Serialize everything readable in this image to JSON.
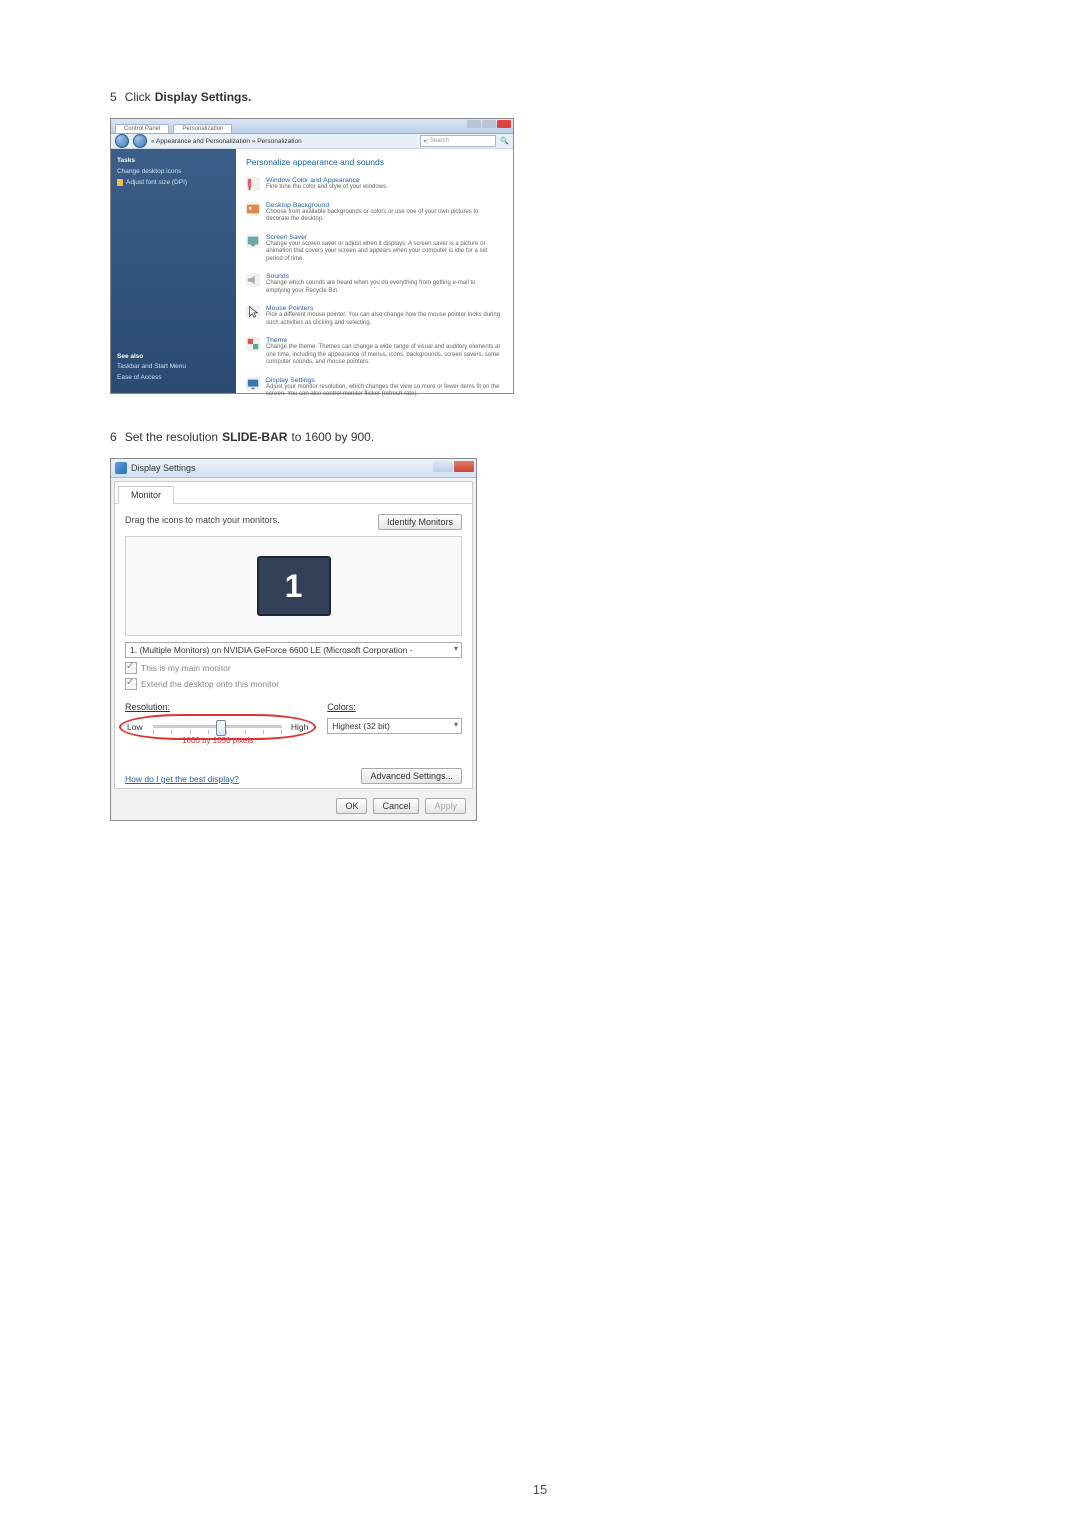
{
  "page_number": "15",
  "step5": {
    "num": "5",
    "prefix": "Click ",
    "bold": "Display Settings."
  },
  "step6": {
    "num": "6",
    "prefix": "Set the resolution ",
    "bold": "SLIDE-BAR",
    "suffix": " to 1600 by 900."
  },
  "win1": {
    "tab_control": "Control Panel",
    "tab_personalize": "Personalization",
    "breadcrumb": "« Appearance and Personalization » Personalization",
    "search_placeholder": "Search",
    "sidebar": {
      "heading": "Tasks",
      "link1": "Change desktop icons",
      "link2": "Adjust font size (DPI)",
      "also": "See also",
      "also1": "Taskbar and Start Menu",
      "also2": "Ease of Access"
    },
    "main_title": "Personalize appearance and sounds",
    "items": [
      {
        "title": "Window Color and Appearance",
        "desc": "Fine tune the color and style of your windows."
      },
      {
        "title": "Desktop Background",
        "desc": "Choose from available backgrounds or colors or use one of your own pictures to decorate the desktop."
      },
      {
        "title": "Screen Saver",
        "desc": "Change your screen saver or adjust when it displays. A screen saver is a picture or animation that covers your screen and appears when your computer is idle for a set period of time."
      },
      {
        "title": "Sounds",
        "desc": "Change which sounds are heard when you do everything from getting e-mail to emptying your Recycle Bin."
      },
      {
        "title": "Mouse Pointers",
        "desc": "Pick a different mouse pointer. You can also change how the mouse pointer looks during such activities as clicking and selecting."
      },
      {
        "title": "Theme",
        "desc": "Change the theme. Themes can change a wide range of visual and auditory elements at one time, including the appearance of menus, icons, backgrounds, screen savers, some computer sounds, and mouse pointers."
      },
      {
        "title": "Display Settings",
        "desc": "Adjust your monitor resolution, which changes the view so more or fewer items fit on the screen. You can also control monitor flicker (refresh rate)."
      }
    ]
  },
  "win2": {
    "title": "Display Settings",
    "tab": "Monitor",
    "drag_text": "Drag the icons to match your monitors.",
    "identify_btn": "Identify Monitors",
    "monitor_number": "1",
    "device": "1. (Multiple Monitors) on NVIDIA GeForce 6600 LE (Microsoft Corporation - ",
    "check1": "This is my main monitor",
    "check2": "Extend the desktop onto this monitor",
    "res_label": "Resolution:",
    "low": "Low",
    "high": "High",
    "res_readout": "1600 by 1050 pixels",
    "col_label": "Colors:",
    "col_value": "Highest (32 bit)",
    "how_link": "How do I get the best display?",
    "adv_btn": "Advanced Settings...",
    "ok": "OK",
    "cancel": "Cancel",
    "apply": "Apply"
  }
}
